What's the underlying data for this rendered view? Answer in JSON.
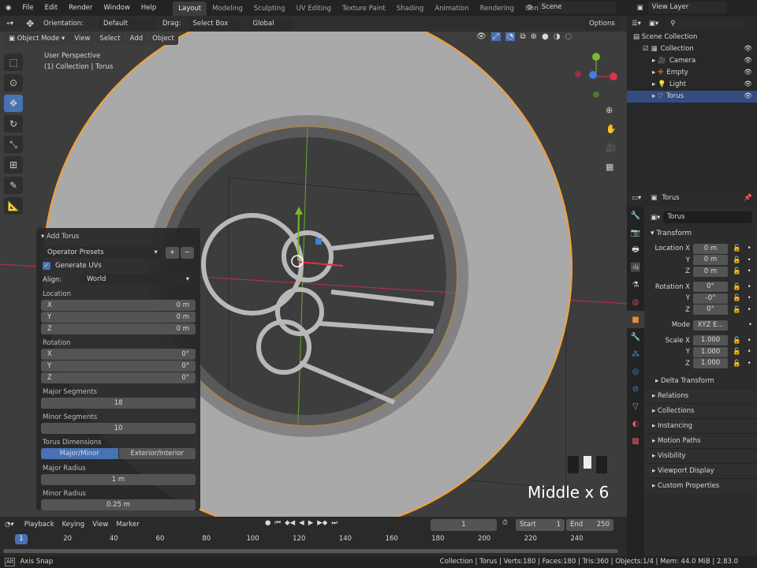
{
  "menu": [
    "File",
    "Edit",
    "Render",
    "Window",
    "Help"
  ],
  "workspaces": [
    "Layout",
    "Modeling",
    "Sculpting",
    "UV Editing",
    "Texture Paint",
    "Shading",
    "Animation",
    "Rendering",
    "Compositing"
  ],
  "scene": "Scene",
  "view_layer": "View Layer",
  "tool_header": {
    "orientation_label": "Orientation:",
    "orientation": "Default",
    "drag_label": "Drag:",
    "drag": "Select Box",
    "transform": "Global",
    "options": "Options"
  },
  "viewport_header": {
    "mode": "Object Mode",
    "menus": [
      "View",
      "Select",
      "Add",
      "Object"
    ]
  },
  "viewport": {
    "perspective": "User Perspective",
    "collection": "(1) Collection | Torus",
    "key_overlay": "Middle x 6"
  },
  "colors": {
    "accent": "#4772b3",
    "selection": "#f5a030",
    "x_axis": "#e0304a",
    "y_axis": "#7ab832",
    "z_axis": "#3d7ee0"
  },
  "add_torus": {
    "title": "Add Torus",
    "presets": "Operator Presets",
    "generate_uvs": "Generate UVs",
    "generate_uvs_checked": true,
    "align_label": "Align:",
    "align": "World",
    "location_label": "Location",
    "location": [
      {
        "k": "X",
        "v": "0 m"
      },
      {
        "k": "Y",
        "v": "0 m"
      },
      {
        "k": "Z",
        "v": "0 m"
      }
    ],
    "rotation_label": "Rotation",
    "rotation": [
      {
        "k": "X",
        "v": "0°"
      },
      {
        "k": "Y",
        "v": "0°"
      },
      {
        "k": "Z",
        "v": "0°"
      }
    ],
    "major_segments_label": "Major Segments",
    "major_segments": "18",
    "minor_segments_label": "Minor Segments",
    "minor_segments": "10",
    "dimensions_label": "Torus Dimensions",
    "dim_options": [
      "Major/Minor",
      "Exterior/Interior"
    ],
    "major_radius_label": "Major Radius",
    "major_radius": "1 m",
    "minor_radius_label": "Minor Radius",
    "minor_radius": "0.25 m"
  },
  "outliner": {
    "root": "Scene Collection",
    "items": [
      "Collection",
      "Camera",
      "Empty",
      "Light",
      "Torus"
    ]
  },
  "properties": {
    "object": "Torus",
    "name": "Torus",
    "transform": "Transform",
    "rows": [
      {
        "l": "Location X",
        "v": "0 m"
      },
      {
        "l": "Y",
        "v": "0 m"
      },
      {
        "l": "Z",
        "v": "0 m"
      },
      {
        "l": "Rotation X",
        "v": "0°"
      },
      {
        "l": "Y",
        "v": "-0°"
      },
      {
        "l": "Z",
        "v": "0°"
      },
      {
        "l": "Mode",
        "v": "XYZ E..."
      },
      {
        "l": "Scale X",
        "v": "1.000"
      },
      {
        "l": "Y",
        "v": "1.000"
      },
      {
        "l": "Z",
        "v": "1.000"
      }
    ],
    "delta": "Delta Transform",
    "sections": [
      "Relations",
      "Collections",
      "Instancing",
      "Motion Paths",
      "Visibility",
      "Viewport Display",
      "Custom Properties"
    ]
  },
  "timeline": {
    "menus": [
      "Playback",
      "Keying",
      "View",
      "Marker"
    ],
    "current": "1",
    "start_label": "Start",
    "start": "1",
    "end_label": "End",
    "end": "250",
    "ticks": [
      "1",
      "20",
      "40",
      "60",
      "80",
      "100",
      "120",
      "140",
      "160",
      "180",
      "200",
      "220",
      "240"
    ]
  },
  "status": {
    "left": "Axis Snap",
    "right": "Collection | Torus | Verts:180 | Faces:180 | Tris:360 | Objects:1/4 | Mem: 44.0 MiB | 2.83.0"
  }
}
